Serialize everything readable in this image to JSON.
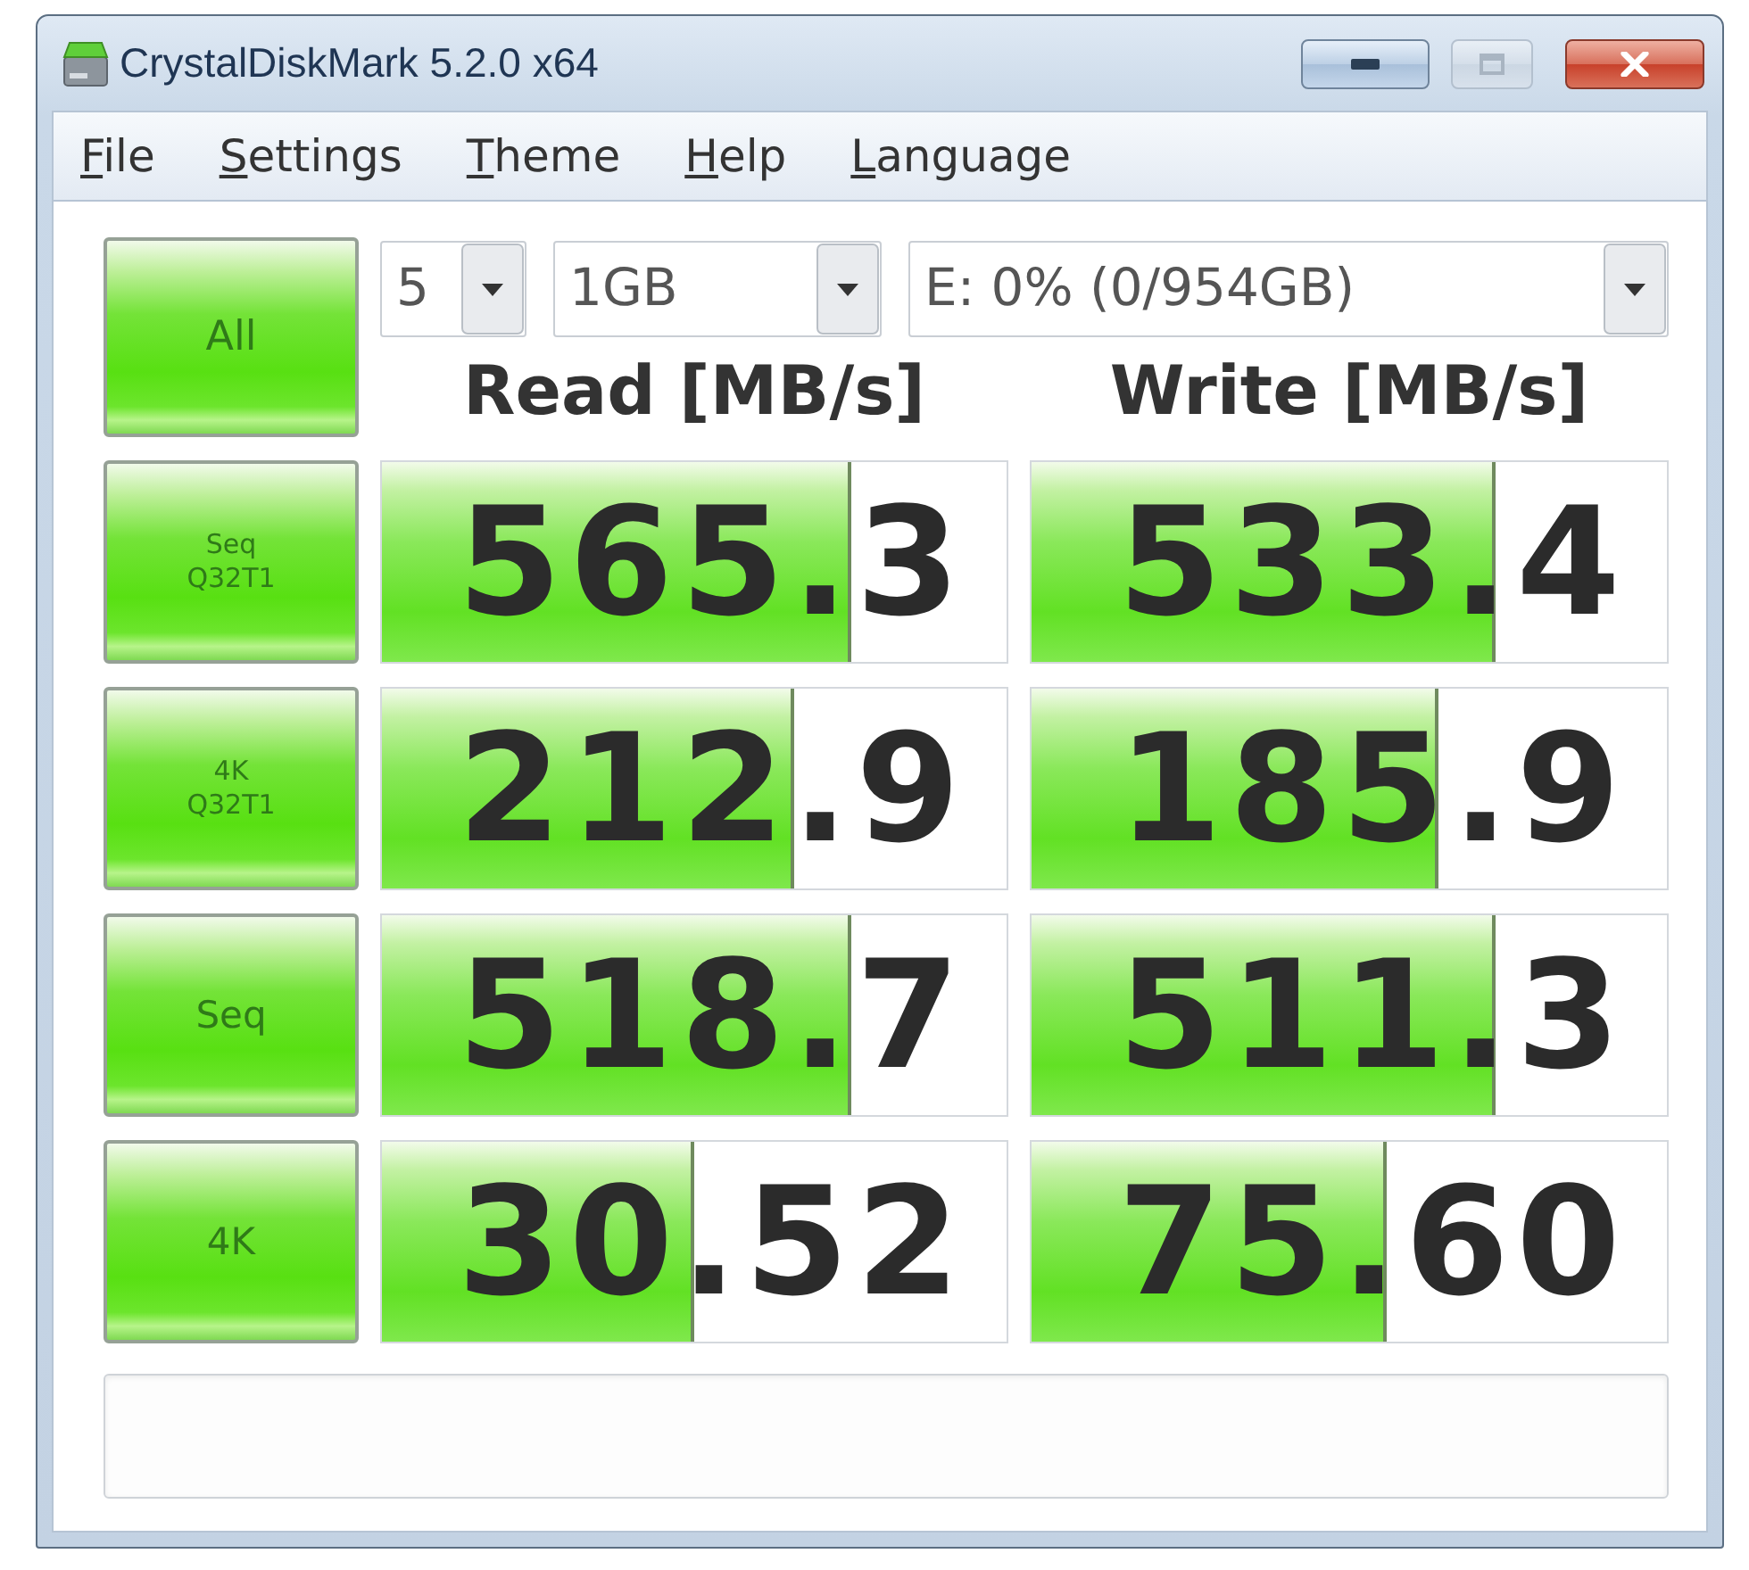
{
  "window": {
    "title": "CrystalDiskMark 5.2.0 x64",
    "maximize_disabled": true
  },
  "menu": [
    {
      "label": "File"
    },
    {
      "label": "Settings"
    },
    {
      "label": "Theme"
    },
    {
      "label": "Help"
    },
    {
      "label": "Language"
    }
  ],
  "controls": {
    "all_button": "All",
    "count": "5",
    "size": "1GB",
    "drive": "E: 0% (0/954GB)"
  },
  "columns": [
    {
      "label": "Read [MB/s]"
    },
    {
      "label": "Write [MB/s]"
    }
  ],
  "tests": [
    {
      "label": "Seq",
      "params": "Q32T1",
      "results": [
        {
          "value": "565.3",
          "level": 0.75
        },
        {
          "value": "533.4",
          "level": 0.73
        }
      ]
    },
    {
      "label": "4K",
      "params": "Q32T1",
      "results": [
        {
          "value": "212.9",
          "level": 0.66
        },
        {
          "value": "185.9",
          "level": 0.64
        }
      ]
    },
    {
      "label": "Seq",
      "results": [
        {
          "value": "518.7",
          "level": 0.75
        },
        {
          "value": "511.3",
          "level": 0.73
        }
      ]
    },
    {
      "label": "4K",
      "results": [
        {
          "value": "30.52",
          "level": 0.5
        },
        {
          "value": "75.60",
          "level": 0.56
        }
      ]
    }
  ]
}
